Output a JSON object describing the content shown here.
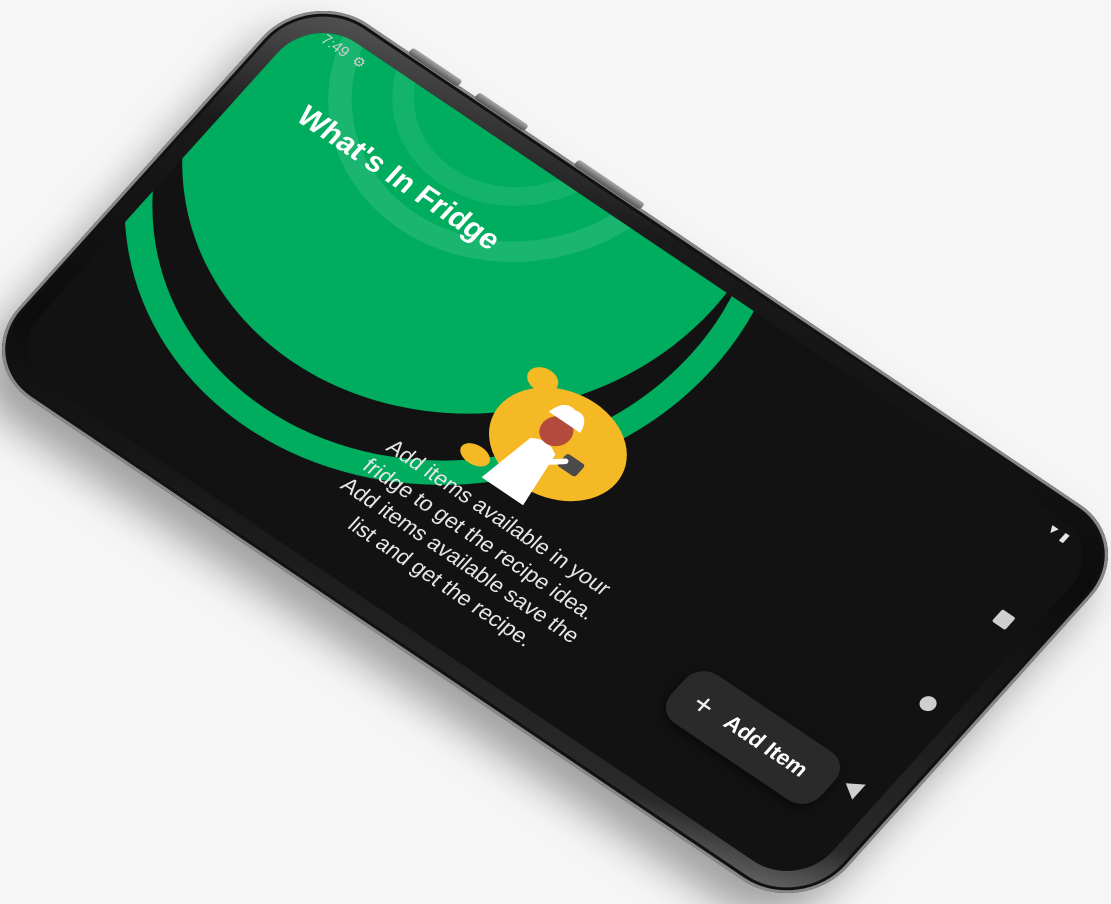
{
  "status_bar": {
    "time": "7:49",
    "settings_icon": "gear-icon",
    "signal_icon": "signal-icon",
    "battery_icon": "battery-icon"
  },
  "app": {
    "title": "What's In Fridge"
  },
  "empty_state": {
    "illustration_icon": "chef-illustration",
    "message": "Add items available in your fridge to get the recipe idea. Add items available save the list and get the recipe."
  },
  "fab": {
    "icon": "plus-icon",
    "label": "Add Item"
  },
  "nav": {
    "recents_icon": "square-icon",
    "home_icon": "circle-icon",
    "back_icon": "triangle-icon"
  },
  "colors": {
    "brand_green": "#00ad5f",
    "background": "#121212",
    "fab_bg": "#2a2a2a",
    "illustration_yellow": "#f5b925"
  }
}
